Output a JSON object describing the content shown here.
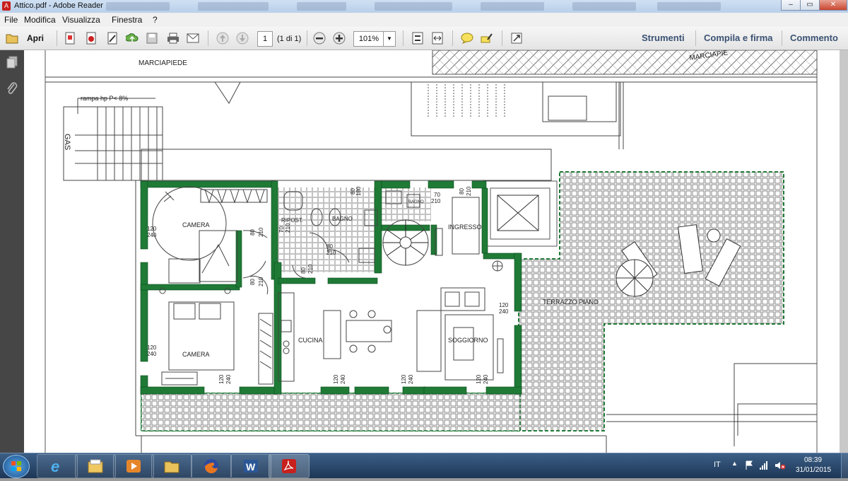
{
  "window": {
    "title": "Attico.pdf - Adobe Reader",
    "app_icon": "adobe-reader-icon",
    "controls": {
      "minimize": "–",
      "maximize": "▭",
      "close": "✕"
    }
  },
  "menu": [
    "File",
    "Modifica",
    "Visualizza",
    "Finestra",
    "?"
  ],
  "toolbar": {
    "open_label": "Apri",
    "page_input": "1",
    "page_count": "(1 di 1)",
    "zoom": "101%",
    "tools_label": "Strumenti",
    "fill_sign_label": "Compila e firma",
    "comment_label": "Commento",
    "icons": [
      "folder-open-icon",
      "create-pdf-icon",
      "convert-icon",
      "edit-icon",
      "upload-icon",
      "save-icon",
      "print-icon",
      "email-icon",
      "prev-page-icon",
      "next-page-icon",
      "zoom-out-icon",
      "zoom-in-icon",
      "fit-page-icon",
      "fit-width-icon",
      "comment-icon",
      "highlight-icon",
      "fullscreen-icon"
    ]
  },
  "left_panel": {
    "icons": [
      "pages-icon",
      "attachments-icon"
    ]
  },
  "plan": {
    "labels": {
      "marciapiede": "MARCIAPIEDE",
      "marciapiede_right": "MARCIAPIE",
      "rampa": "rampa hp P< 8%",
      "gas": "GAS",
      "camera1": "CAMERA",
      "camera2": "CAMERA",
      "ripost": "RIPOST.",
      "bagno": "BAGNO",
      "bagno2": "BAGNO",
      "ingresso": "INGRESSO",
      "cucina": "CUCINA",
      "soggiorno": "SOGGIORNO",
      "terrazzo": "TERRAZZO PIANO"
    },
    "dims": {
      "w1": [
        "120",
        "240"
      ],
      "w2": [
        "120",
        "240"
      ],
      "w3": [
        "120",
        "240"
      ],
      "d1": [
        "80",
        "210"
      ],
      "d2": [
        "80",
        "210"
      ],
      "d3": [
        "80",
        "210"
      ],
      "d4": [
        "80",
        "210"
      ],
      "d5": [
        "70",
        "210"
      ],
      "d6": [
        "70",
        "210"
      ],
      "d7": [
        "80",
        "210"
      ],
      "top1": [
        "80",
        "180"
      ],
      "top2": [
        "80",
        "210"
      ],
      "top3": [
        "70",
        "210"
      ],
      "bottom1": [
        "120",
        "240"
      ],
      "bottom2": [
        "120",
        "240"
      ],
      "bottom3": [
        "120",
        "240"
      ],
      "bottom4": [
        "120",
        "240"
      ],
      "sogg": [
        "120",
        "240"
      ]
    },
    "colors": {
      "wall": "#1f7a36",
      "line": "#444444"
    }
  },
  "taskbar": {
    "start_icon": "windows-start-icon",
    "apps": [
      "internet-explorer-icon",
      "file-explorer-icon",
      "media-player-icon",
      "folder-icon",
      "firefox-icon",
      "word-icon",
      "adobe-reader-icon"
    ],
    "lang": "IT",
    "time": "08:39",
    "date": "31/01/2015",
    "tray_icons": [
      "show-hidden-icon",
      "flag-icon",
      "network-icon",
      "volume-icon"
    ]
  }
}
